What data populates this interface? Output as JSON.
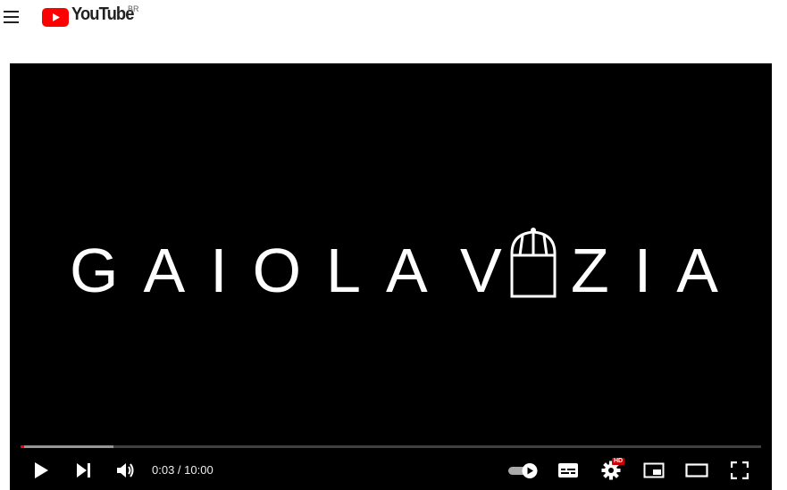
{
  "header": {
    "menu_icon": "hamburger-menu-icon",
    "logo_wordmark": "YouTube",
    "logo_country": "BR",
    "brand_color": "#ff0000"
  },
  "player": {
    "title_left": "GAIOLA",
    "title_right_1": "V",
    "title_right_2": "ZIA",
    "title_icon": "birdcage-icon",
    "time_display": "0:03 / 10:00",
    "progress_played": 0.005,
    "progress_buffered": 0.125,
    "hd_badge": "HD",
    "autoplay_on": true,
    "controls": {
      "play": "play-icon",
      "next": "next-icon",
      "volume": "volume-icon",
      "autoplay": "autoplay-toggle-icon",
      "subtitles": "subtitles-icon",
      "settings": "settings-gear-icon",
      "miniplayer": "miniplayer-icon",
      "theater": "theater-mode-icon",
      "fullscreen": "fullscreen-icon"
    }
  }
}
